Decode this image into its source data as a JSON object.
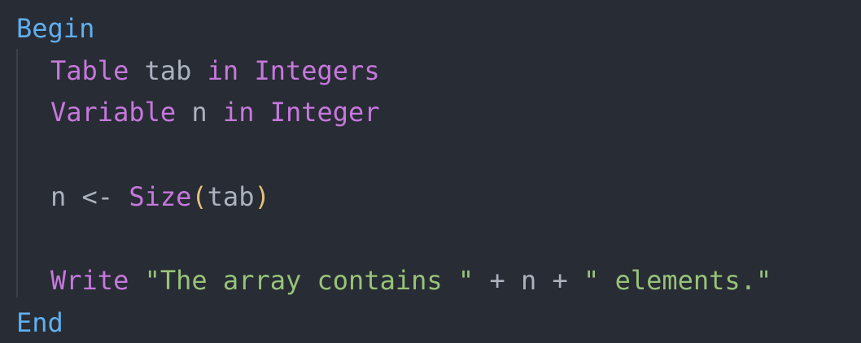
{
  "code": {
    "begin": "Begin",
    "end": "End",
    "line1": {
      "table_kw": "Table",
      "name": "tab",
      "in_kw": "in",
      "type": "Integers"
    },
    "line2": {
      "var_kw": "Variable",
      "name": "n",
      "in_kw": "in",
      "type": "Integer"
    },
    "line4": {
      "target": "n",
      "assign": "<-",
      "func": "Size",
      "open": "(",
      "arg": "tab",
      "close": ")"
    },
    "line6": {
      "write_kw": "Write",
      "str1": "\"The array contains \"",
      "plus1": "+",
      "var": "n",
      "plus2": "+",
      "str2": "\" elements.\""
    }
  },
  "colors": {
    "background": "#282c34",
    "block_keyword": "#61afef",
    "keyword": "#c678dd",
    "identifier": "#abb2bf",
    "paren": "#e5c07b",
    "string": "#98c379",
    "indent_guide": "#3b4048"
  }
}
